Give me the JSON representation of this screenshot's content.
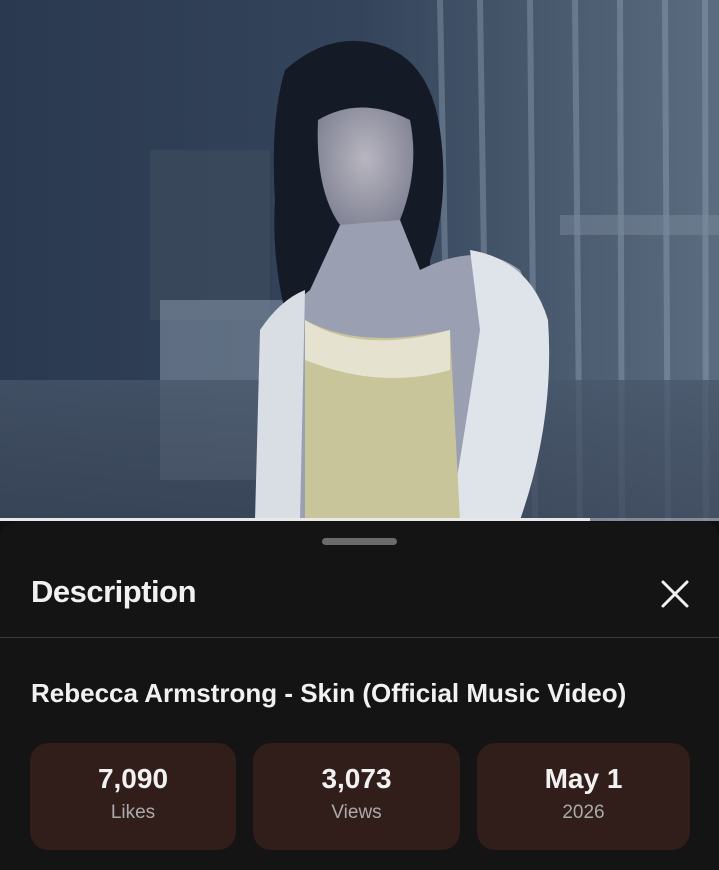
{
  "video": {
    "thumbnail": "music-video-frame",
    "progress_fraction": 0.82
  },
  "description_panel": {
    "heading": "Description",
    "close_icon": "close-icon"
  },
  "video_info": {
    "title": "Rebecca Armstrong - Skin (Official Music Video)",
    "stats": [
      {
        "value": "7,090",
        "label": "Likes"
      },
      {
        "value": "3,073",
        "label": "Views"
      },
      {
        "value": "May 1",
        "label": "2026"
      }
    ]
  },
  "colors": {
    "background": "#0f0f0f",
    "sheet": "#141414",
    "stat_card": "#311d1a",
    "text_primary": "#f1f1f1",
    "text_secondary": "#aaaaaa"
  }
}
